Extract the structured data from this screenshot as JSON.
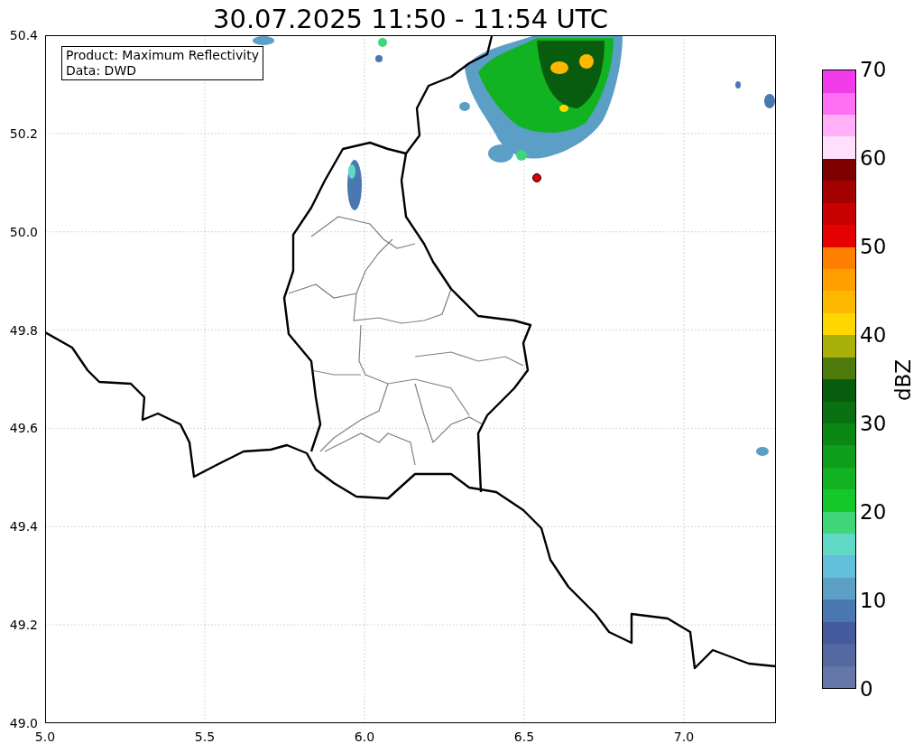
{
  "title": "30.07.2025 11:50 - 11:54 UTC",
  "info_box": [
    "Product: Maximum Reflectivity",
    "Data: DWD"
  ],
  "map": {
    "xticks": [
      "5.0",
      "5.5",
      "6.0",
      "6.5",
      "7.0"
    ],
    "yticks": [
      "50.4",
      "50.2",
      "50.0",
      "49.8",
      "49.6",
      "49.4",
      "49.2",
      "49.0"
    ]
  },
  "colorbar": {
    "label": "dBZ",
    "ticks": [
      "70",
      "60",
      "50",
      "40",
      "30",
      "20",
      "10",
      "0"
    ],
    "bands": [
      {
        "color": "#6477a8"
      },
      {
        "color": "#5468a2"
      },
      {
        "color": "#455b9e"
      },
      {
        "color": "#4a78b0"
      },
      {
        "color": "#5b9ec6"
      },
      {
        "color": "#62bedb"
      },
      {
        "color": "#60d8c6"
      },
      {
        "color": "#3fd67a"
      },
      {
        "color": "#14c82a"
      },
      {
        "color": "#11b322"
      },
      {
        "color": "#0e9e1c"
      },
      {
        "color": "#0b8716"
      },
      {
        "color": "#097111"
      },
      {
        "color": "#085c0d"
      },
      {
        "color": "#4d7a0a"
      },
      {
        "color": "#a9b00a"
      },
      {
        "color": "#ffd700"
      },
      {
        "color": "#ffb800"
      },
      {
        "color": "#ff9f00"
      },
      {
        "color": "#ff8000"
      },
      {
        "color": "#e60000"
      },
      {
        "color": "#c80000"
      },
      {
        "color": "#a50000"
      },
      {
        "color": "#7f0000"
      },
      {
        "color": "#ffe0fc"
      },
      {
        "color": "#ffb0f8"
      },
      {
        "color": "#ff70f4"
      },
      {
        "color": "#f03ceb"
      }
    ]
  }
}
